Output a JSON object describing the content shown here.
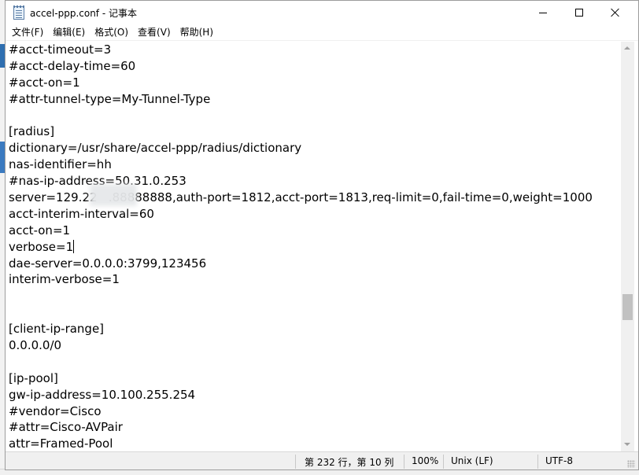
{
  "window": {
    "title": "accel-ppp.conf - 记事本",
    "app_icon": "notepad-icon"
  },
  "menu": [
    {
      "label": "文件(F)"
    },
    {
      "label": "编辑(E)"
    },
    {
      "label": "格式(O)"
    },
    {
      "label": "查看(V)"
    },
    {
      "label": "帮助(H)"
    }
  ],
  "editor": {
    "lines": [
      "#acct-timeout=3",
      "#acct-delay-time=60",
      "#acct-on=1",
      "#attr-tunnel-type=My-Tunnel-Type",
      "",
      "[radius]",
      "dictionary=/usr/share/accel-ppp/radius/dictionary",
      "nas-identifier=hh",
      "#nas-ip-address=50.31.0.253",
      "server=129.22   .88888888,auth-port=1812,acct-port=1813,req-limit=0,fail-time=0,weight=1000",
      "acct-interim-interval=60",
      "acct-on=1",
      "verbose=1",
      "dae-server=0.0.0.0:3799,123456",
      "interim-verbose=1",
      "",
      "",
      "[client-ip-range]",
      "0.0.0.0/0",
      "",
      "[ip-pool]",
      "gw-ip-address=10.100.255.254",
      "#vendor=Cisco",
      "#attr=Cisco-AVPair",
      "attr=Framed-Pool"
    ],
    "caret_line_index": 12
  },
  "statusbar": {
    "position": "第 232 行，第 10 列",
    "zoom": "100%",
    "line_ending": "Unix (LF)",
    "encoding": "UTF-8"
  },
  "colors": {
    "scroll_thumb": "#c1c1c1",
    "statusbar_bg": "#f0f0f0"
  }
}
